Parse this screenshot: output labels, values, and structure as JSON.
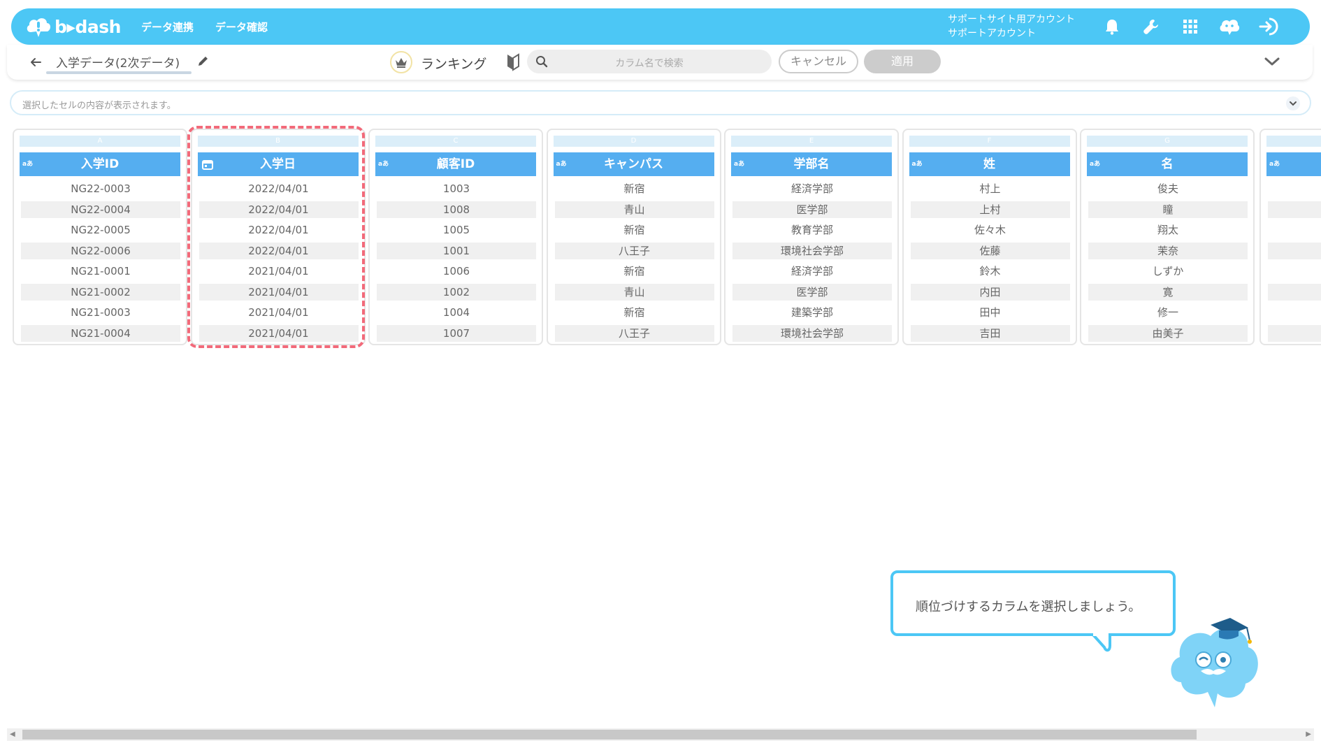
{
  "header": {
    "logo_text": "b▸dash",
    "nav": [
      "データ連携",
      "データ確認"
    ],
    "account_line1": "サポートサイト用アカウント",
    "account_line2": "サポートアカウント",
    "icons": [
      "bell-icon",
      "wrench-icon",
      "grid-icon",
      "chat-bot-icon",
      "logout-icon"
    ]
  },
  "subbar": {
    "dataset_title": "入学データ(2次データ)",
    "mode_label": "ランキング",
    "search_placeholder": "カラム名で検索",
    "cancel_label": "キャンセル",
    "apply_label": "適用"
  },
  "cellbar": {
    "placeholder": "選択したセルの内容が表示されます。"
  },
  "columns": [
    {
      "letter": "A",
      "type": "aあ",
      "name": "入学ID",
      "values": [
        "NG22-0003",
        "NG22-0004",
        "NG22-0005",
        "NG22-0006",
        "NG21-0001",
        "NG21-0002",
        "NG21-0003",
        "NG21-0004"
      ]
    },
    {
      "letter": "B",
      "type": "date",
      "name": "入学日",
      "values": [
        "2022/04/01",
        "2022/04/01",
        "2022/04/01",
        "2022/04/01",
        "2021/04/01",
        "2021/04/01",
        "2021/04/01",
        "2021/04/01"
      ]
    },
    {
      "letter": "C",
      "type": "aあ",
      "name": "顧客ID",
      "values": [
        "1003",
        "1008",
        "1005",
        "1001",
        "1006",
        "1002",
        "1004",
        "1007"
      ]
    },
    {
      "letter": "D",
      "type": "aあ",
      "name": "キャンパス",
      "values": [
        "新宿",
        "青山",
        "新宿",
        "八王子",
        "新宿",
        "青山",
        "新宿",
        "八王子"
      ]
    },
    {
      "letter": "E",
      "type": "aあ",
      "name": "学部名",
      "values": [
        "経済学部",
        "医学部",
        "教育学部",
        "環境社会学部",
        "経済学部",
        "医学部",
        "建築学部",
        "環境社会学部"
      ]
    },
    {
      "letter": "F",
      "type": "aあ",
      "name": "姓",
      "values": [
        "村上",
        "上村",
        "佐々木",
        "佐藤",
        "鈴木",
        "内田",
        "田中",
        "吉田"
      ]
    },
    {
      "letter": "G",
      "type": "aあ",
      "name": "名",
      "values": [
        "俊夫",
        "瞳",
        "翔太",
        "茉奈",
        "しずか",
        "寛",
        "修一",
        "由美子"
      ]
    },
    {
      "letter": "",
      "type": "aあ",
      "name": "",
      "values": [
        "",
        "",
        "",
        "",
        "",
        "",
        "",
        ""
      ]
    }
  ],
  "guide": {
    "message": "順位づけするカラムを選択しましょう。"
  },
  "colors": {
    "brand": "#4cc7f5",
    "column_header": "#55aef0",
    "selection_outline": "#f26a7a"
  }
}
